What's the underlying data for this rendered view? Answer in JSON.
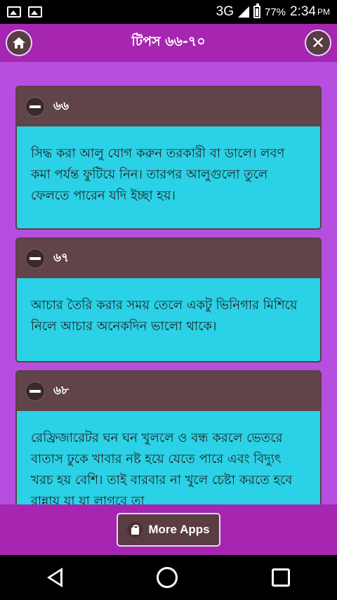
{
  "status_bar": {
    "network": "3G",
    "battery": "77%",
    "time": "2:34",
    "ampm": "PM"
  },
  "header": {
    "title": "টিপস ৬৬-৭০"
  },
  "cards": [
    {
      "number": "৬৬",
      "text": "সিদ্ধ করা আলু যোগ করুন তরকারী বা ডালে। লবণ কমা পর্যন্ত ফুটিয়ে নিন। তারপর আলুগুলো তুলে ফেলতে পারেন যদি ইচ্ছা হয়।"
    },
    {
      "number": "৬৭",
      "text": "আচার তৈরি করার সময় তেলে একটু ভিনিগার মিশিয়ে নিলে আচার অনেকদিন ভালো থাকে।"
    },
    {
      "number": "৬৮",
      "text": "রেফ্রিজারেটর ঘন ঘন খুললে ও বন্ধ করলে ভেতরে বাতাস ঢুকে খাবার নষ্ট হয়ে যেতে পারে এবং বিদ্যুৎ খরচ হয় বেশি। তাই বারবার না খুলে চেষ্টা করতে হবে রান্নায় যা যা লাগবে তা"
    }
  ],
  "bottom": {
    "more_apps_label": "More Apps"
  },
  "colors": {
    "background": "#b64fe0",
    "header": "#a625b1",
    "card_head": "#604449",
    "card_body": "#2bd1e6"
  }
}
